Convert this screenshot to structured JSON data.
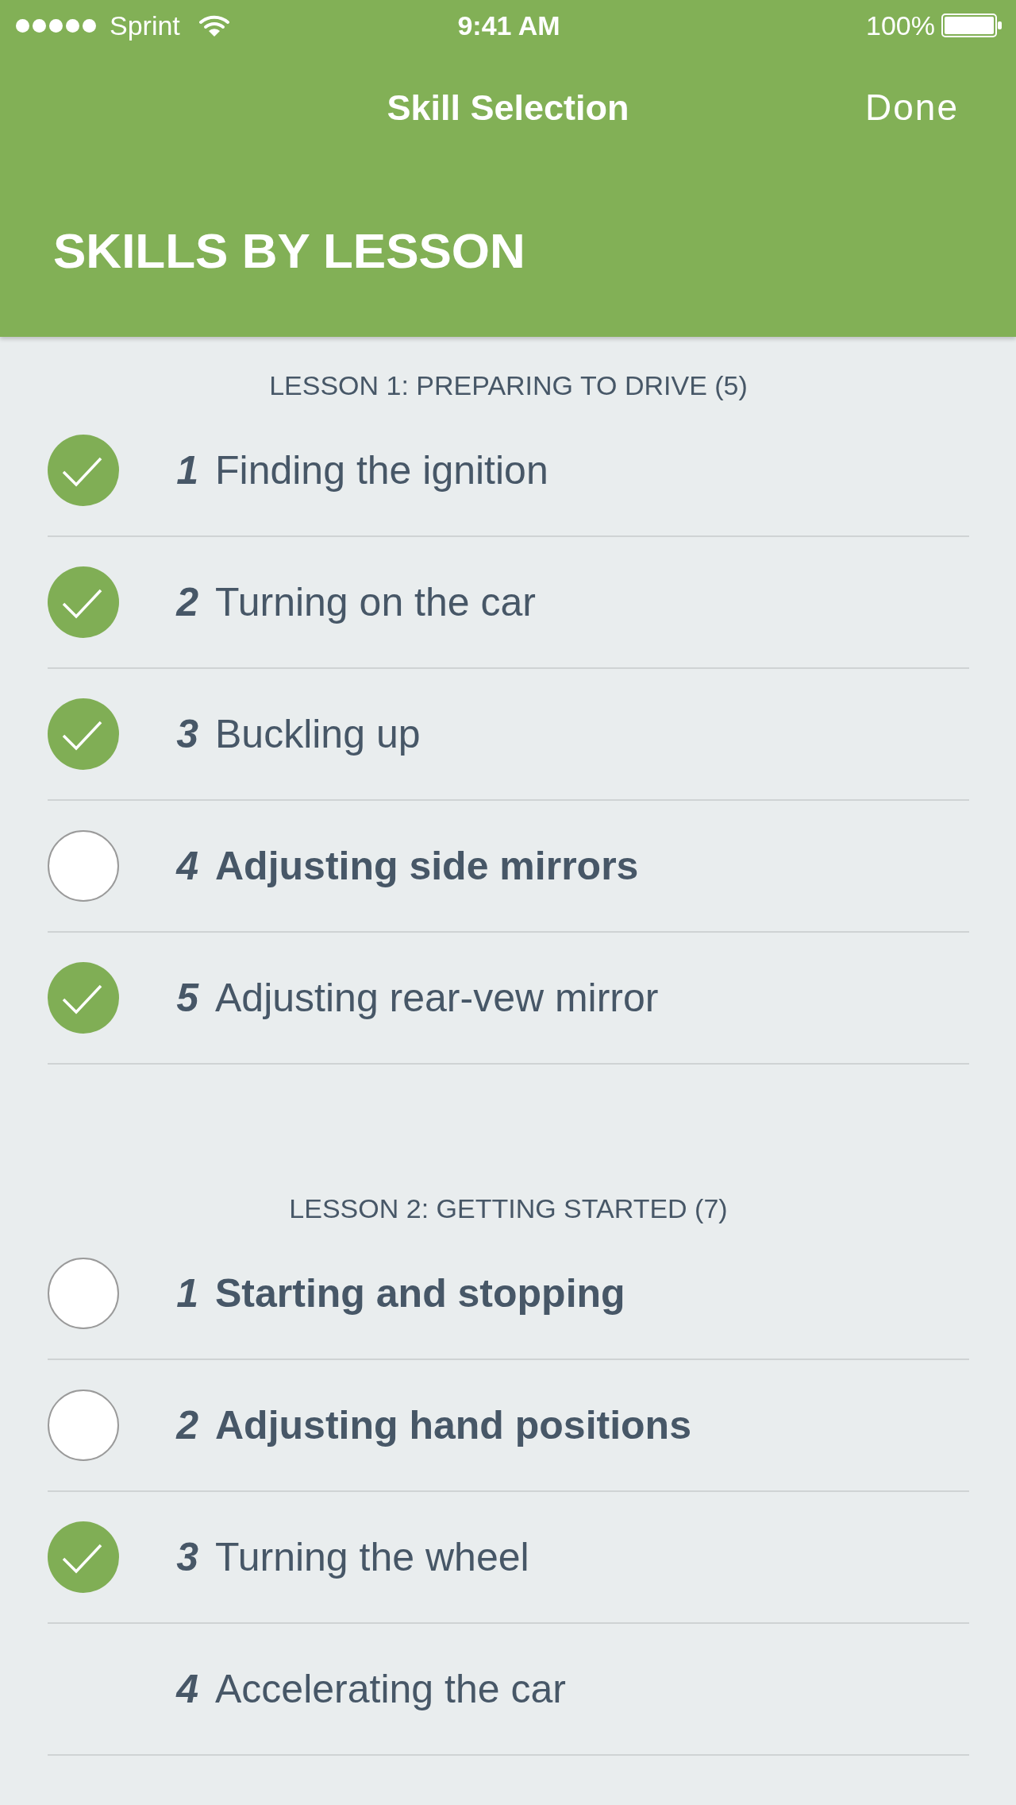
{
  "status_bar": {
    "carrier": "Sprint",
    "time": "9:41 AM",
    "battery": "100%"
  },
  "nav_bar": {
    "title": "Skill Selection",
    "done": "Done"
  },
  "header": {
    "title": "SKILLS BY LESSON"
  },
  "lessons": [
    {
      "title": "LESSON 1: PREPARING TO DRIVE (5)",
      "skills": [
        {
          "kind": "checkbox",
          "number": "1",
          "label": "Finding the ignition",
          "checked": true
        },
        {
          "kind": "checkbox",
          "number": "2",
          "label": "Turning on the car",
          "checked": true
        },
        {
          "kind": "checkbox",
          "number": "3",
          "label": "Buckling up",
          "checked": true
        },
        {
          "kind": "checkbox",
          "number": "4",
          "label": "Adjusting side mirrors",
          "checked": false
        },
        {
          "kind": "checkbox",
          "number": "5",
          "label": "Adjusting rear-vew mirror",
          "checked": true
        }
      ]
    },
    {
      "title": "LESSON 2: GETTING STARTED (7)",
      "skills": [
        {
          "kind": "checkbox",
          "number": "1",
          "label": "Starting and stopping",
          "checked": false
        },
        {
          "kind": "checkbox",
          "number": "2",
          "label": "Adjusting hand positions",
          "checked": false
        },
        {
          "kind": "checkbox",
          "number": "3",
          "label": "Turning the wheel",
          "checked": true
        },
        {
          "kind": "plain",
          "number": "4",
          "label": "Accelerating the car"
        }
      ]
    }
  ]
}
